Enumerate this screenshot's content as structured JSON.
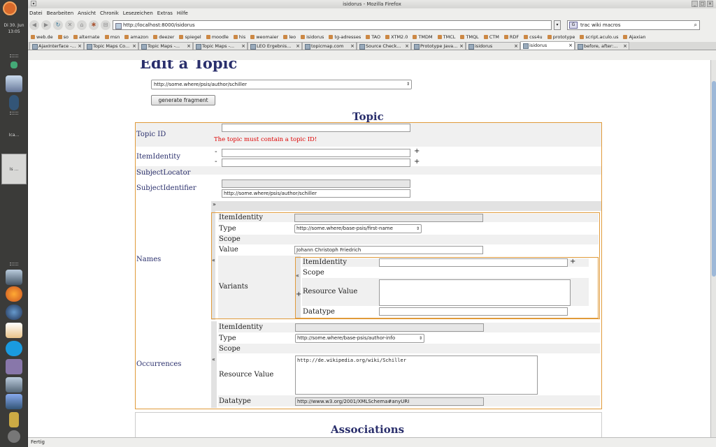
{
  "desktop": {
    "clock": "Di 30. Jun\n13:05",
    "tasks": [
      "Ica...",
      "Is ..."
    ]
  },
  "window": {
    "title": "isidorus - Mozilla Firefox"
  },
  "menu": [
    "Datei",
    "Bearbeiten",
    "Ansicht",
    "Chronik",
    "Lesezeichen",
    "Extras",
    "Hilfe"
  ],
  "nav": {
    "url": "http://localhost:8000/isidorus",
    "search": "trac wiki macros"
  },
  "bookmarks": [
    "web.de",
    "so",
    "alternate",
    "msn",
    "amazon",
    "deezer",
    "spiegel",
    "moodle",
    "his",
    "weomaier",
    "leo",
    "isidorus",
    "tg-adresses",
    "TAO",
    "XTM2.0",
    "TMDM",
    "TMCL",
    "TMQL",
    "CTM",
    "RDF",
    "css4u",
    "prototype",
    "script.aculo.us",
    "Ajaxian"
  ],
  "tabs": [
    "AjaxInterface -...",
    "Topic Maps Co...",
    "Topic Maps -...",
    "Topic Maps -...",
    "LEO Ergebnis...",
    "topicmap.com",
    "Source Check...",
    "Prototype Java...",
    "isidorus",
    "isidorus",
    "before, after:..."
  ],
  "page": {
    "title": "Edit a Topic",
    "psi_value": "http://some.where/psis/author/schiller",
    "generate_label": "generate fragment",
    "topic_heading": "Topic",
    "associations_heading": "Associations",
    "topic": {
      "topic_id_label": "Topic ID",
      "topic_id_value": "",
      "topic_id_error": "The topic must contain a topic ID!",
      "item_identity_label": "ItemIdentity",
      "subject_locator_label": "SubjectLocator",
      "subject_identifier_label": "SubjectIdentifier",
      "subject_identifier_value": "http://some.where/psis/author/schiller",
      "minus": "-",
      "plus": "+",
      "collapse": "»",
      "expand": "«"
    },
    "names": {
      "label": "Names",
      "item_identity_label": "ItemIdentity",
      "type_label": "Type",
      "type_value": "http://some.where/base-psis/first-name",
      "scope_label": "Scope",
      "value_label": "Value",
      "value": "Johann Christoph Friedrich",
      "variants": {
        "label": "Variants",
        "item_identity_label": "ItemIdentity",
        "scope_label": "Scope",
        "resource_value_label": "Resource Value",
        "datatype_label": "Datatype"
      }
    },
    "occurrences": {
      "label": "Occurrences",
      "item_identity_label": "ItemIdentity",
      "type_label": "Type",
      "type_value": "http://some.where/base-psis/author-info",
      "scope_label": "Scope",
      "resource_value_label": "Resource Value",
      "resource_value": "http://de.wikipedia.org/wiki/Schiller",
      "datatype_label": "Datatype",
      "datatype_value": "http://www.w3.org/2001/XMLSchema#anyURI"
    }
  },
  "status": "Fertig"
}
